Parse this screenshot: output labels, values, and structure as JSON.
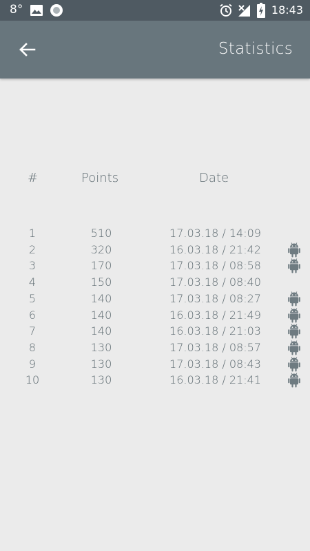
{
  "status_bar": {
    "temperature": "8°",
    "time": "18:43"
  },
  "app_bar": {
    "title": "Statistics",
    "back_icon": "arrow-back-icon"
  },
  "table": {
    "headers": {
      "rank": "#",
      "points": "Points",
      "date": "Date"
    },
    "rows": [
      {
        "rank": "1",
        "points": "510",
        "date": "17.03.18 / 14:09",
        "android": false
      },
      {
        "rank": "2",
        "points": "320",
        "date": "16.03.18 / 21:42",
        "android": true
      },
      {
        "rank": "3",
        "points": "170",
        "date": "17.03.18 / 08:58",
        "android": true
      },
      {
        "rank": "4",
        "points": "150",
        "date": "17.03.18 / 08:40",
        "android": false
      },
      {
        "rank": "5",
        "points": "140",
        "date": "17.03.18 / 08:27",
        "android": true
      },
      {
        "rank": "6",
        "points": "140",
        "date": "16.03.18 / 21:49",
        "android": true
      },
      {
        "rank": "7",
        "points": "140",
        "date": "16.03.18 / 21:03",
        "android": true
      },
      {
        "rank": "8",
        "points": "130",
        "date": "17.03.18 / 08:57",
        "android": true
      },
      {
        "rank": "9",
        "points": "130",
        "date": "17.03.18 / 08:43",
        "android": true
      },
      {
        "rank": "10",
        "points": "130",
        "date": "16.03.18 / 21:41",
        "android": true
      }
    ]
  },
  "colors": {
    "status_bar": "#4f5a62",
    "app_bar": "#68767d",
    "background": "#ebebeb",
    "text": "#5e6b71"
  }
}
